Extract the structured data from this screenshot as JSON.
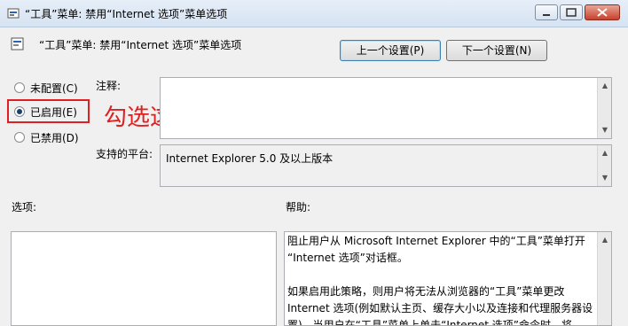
{
  "window": {
    "title": "“工具”菜单: 禁用“Internet 选项”菜单选项",
    "heading": "“工具”菜单: 禁用“Internet 选项”菜单选项"
  },
  "nav": {
    "prev_label": "上一个设置(P)",
    "next_label": "下一个设置(N)"
  },
  "options": {
    "not_configured": "未配置(C)",
    "enabled": "已启用(E)",
    "disabled": "已禁用(D)",
    "selected": "enabled"
  },
  "annotation": "勾选这里",
  "comment_label": "注释:",
  "platform_label": "支持的平台:",
  "platform_value": "Internet Explorer 5.0 及以上版本",
  "options_label": "选项:",
  "help_label": "帮助:",
  "help_lines": [
    "阻止用户从 Microsoft Internet Explorer 中的“工具”菜单打开",
    "“Internet 选项”对话框。",
    "",
    "如果启用此策略，则用户将无法从浏览器的“工具”菜单更改",
    "Internet 选项(例如默认主页、缓存大小以及连接和代理服务器设",
    "置)。当用户在“工具”菜单上单击“Internet 选项”命令时，将"
  ],
  "colors": {
    "annotation": "#e02020",
    "titlebar": "#dae5f3"
  }
}
